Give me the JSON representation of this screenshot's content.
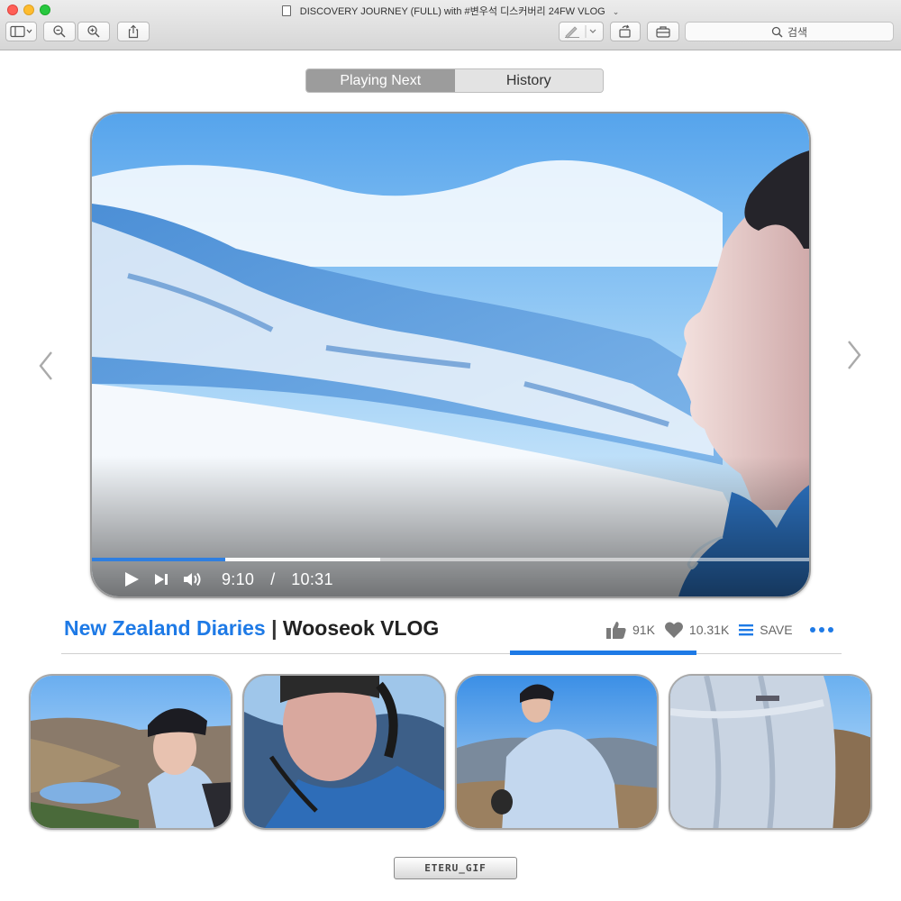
{
  "window": {
    "title": "DISCOVERY JOURNEY (FULL) with #변우석 디스커버리 24FW VLOG"
  },
  "toolbar": {
    "search_placeholder": "검색"
  },
  "tabs": [
    {
      "label": "Playing Next",
      "active": true
    },
    {
      "label": "History",
      "active": false
    }
  ],
  "player": {
    "current_time": "9:10",
    "time_separator": "/",
    "duration": "10:31",
    "progress_fraction": 0.185,
    "buffer_fraction": 0.4
  },
  "video": {
    "title_primary": "New Zealand Diaries",
    "title_separator": "|",
    "title_secondary": "Wooseok VLOG",
    "likes": "91K",
    "hearts": "10.31K",
    "save_label": "SAVE"
  },
  "credit": {
    "label": "ETERU_GIF"
  },
  "colors": {
    "accent": "#1e7ae6",
    "tab_active": "#9c9c9c"
  }
}
